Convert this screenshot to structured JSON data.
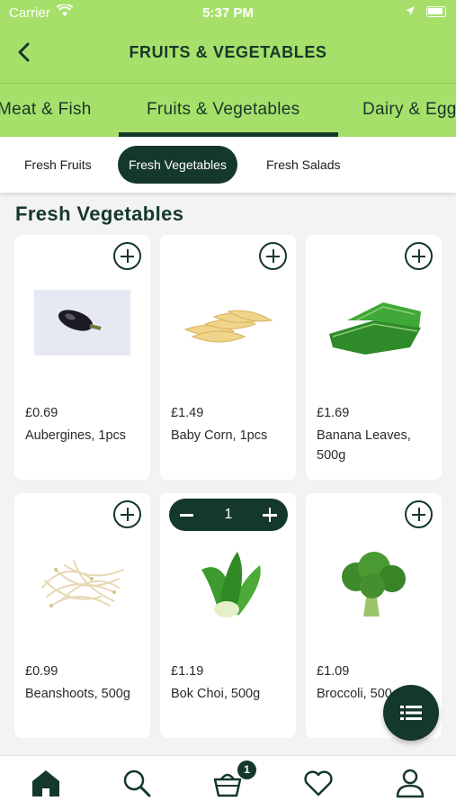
{
  "status_bar": {
    "carrier": "Carrier",
    "time": "5:37 PM"
  },
  "header": {
    "title": "FRUITS & VEGETABLES"
  },
  "category_tabs": [
    {
      "label": "Meat & Fish"
    },
    {
      "label": "Fruits & Vegetables",
      "active": true
    },
    {
      "label": "Dairy & Eggs"
    }
  ],
  "sub_tabs": [
    {
      "label": "Fresh Fruits"
    },
    {
      "label": "Fresh Vegetables",
      "active": true
    },
    {
      "label": "Fresh Salads"
    }
  ],
  "section_title": "Fresh Vegetables",
  "products": [
    {
      "price": "£0.69",
      "name": "Aubergines, 1pcs",
      "image": "aubergine"
    },
    {
      "price": "£1.49",
      "name": "Baby Corn, 1pcs",
      "image": "baby-corn"
    },
    {
      "price": "£1.69",
      "name": "Banana Leaves, 500g",
      "image": "banana-leaves"
    },
    {
      "price": "£0.99",
      "name": "Beanshoots, 500g",
      "image": "beanshoots"
    },
    {
      "price": "£1.19",
      "name": "Bok Choi, 500g",
      "image": "bok-choi",
      "quantity": "1"
    },
    {
      "price": "£1.09",
      "name": "Broccoli, 500g",
      "image": "broccoli"
    }
  ],
  "cart": {
    "badge_count": "1"
  },
  "colors": {
    "header_green": "#a6e06a",
    "dark_green": "#15382c"
  }
}
